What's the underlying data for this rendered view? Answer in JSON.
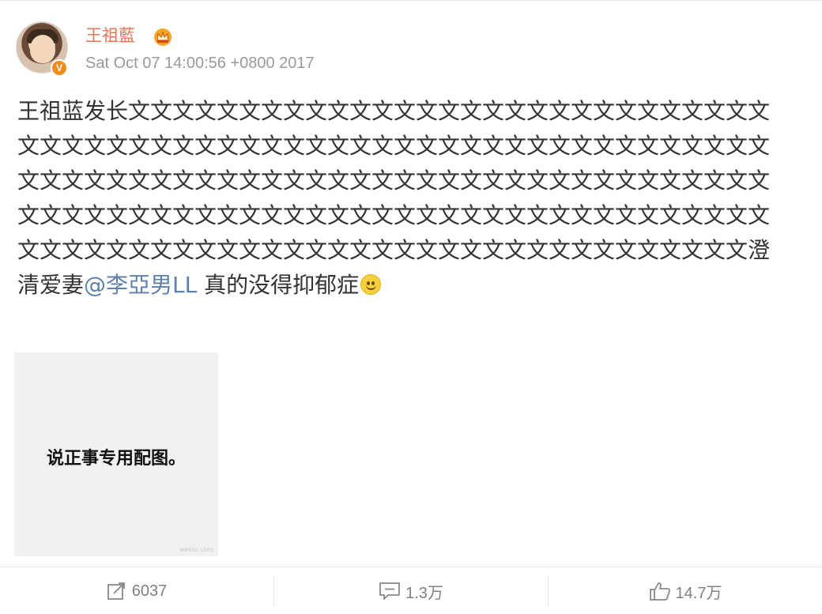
{
  "post": {
    "author": "王祖藍",
    "timestamp": "Sat Oct 07 14:00:56 +0800 2017",
    "text_prefix": "王祖蓝发长文文文文文文文文文文文文文文文文文文文文文文文文文文文文文文文文文文文文文文文文文文文文文文文文文文文文文文文文文文文文文文文文文文文文文文文文文文文文文文文文文文文文文文文文文文文文文文文文文文文文文文文文文文文文文文文文文文文文文文文文文文文文文文文文文文文文文文文文文文文文文文文文文文文文文文文文文文文文文文文文文文文文澄清爱妻",
    "mention": "@李亞男LL",
    "text_suffix": " 真的没得抑郁症",
    "emoji": "smiley-emoji",
    "image_caption": "说正事专用配图。",
    "image_watermark": "weibo.com"
  },
  "actions": {
    "repost_count": "6037",
    "comment_count": "1.3万",
    "like_count": "14.7万"
  },
  "colors": {
    "author": "#eb7350",
    "mention": "#5d7fae",
    "muted": "#9a9a9a"
  }
}
